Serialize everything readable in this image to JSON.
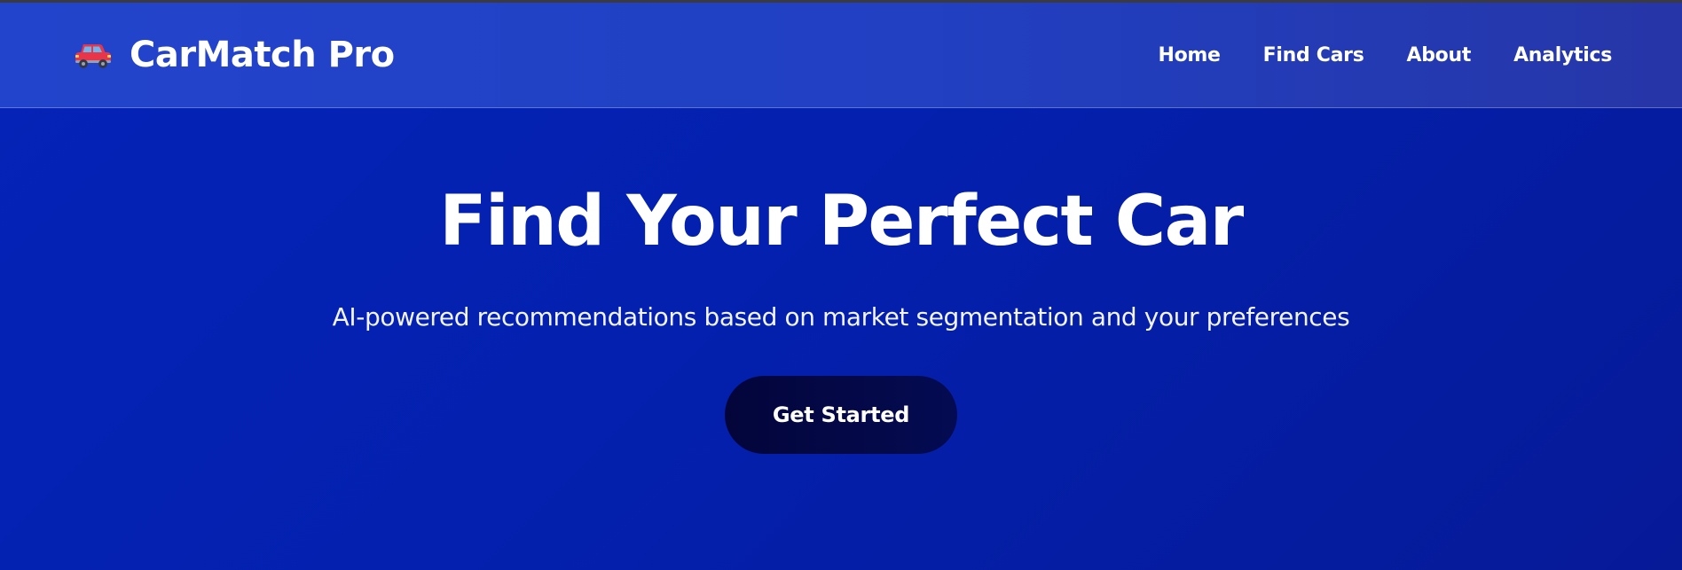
{
  "header": {
    "brand_icon": "red-car-icon",
    "brand_name": "CarMatch Pro",
    "nav": [
      {
        "label": "Home"
      },
      {
        "label": "Find Cars"
      },
      {
        "label": "About"
      },
      {
        "label": "Analytics"
      }
    ]
  },
  "hero": {
    "title": "Find Your Perfect Car",
    "subtitle": "AI-powered recommendations based on market segmentation and your preferences",
    "cta_label": "Get Started"
  },
  "colors": {
    "background": "#0320ae",
    "header_background": "#2244cc",
    "button_background": "#03053a",
    "text": "#ffffff",
    "icon_car_body": "#e8354a"
  }
}
